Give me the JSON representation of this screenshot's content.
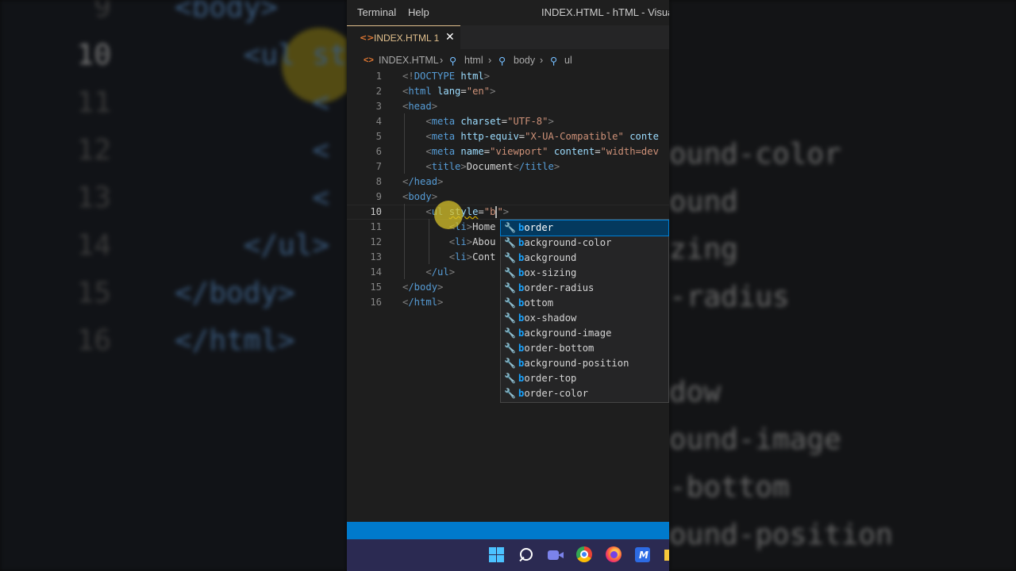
{
  "background": {
    "left_lines": [
      {
        "num": "9",
        "code": "<body>"
      },
      {
        "num": "10",
        "code": "    <ul sty"
      },
      {
        "num": "11",
        "code": "        <"
      },
      {
        "num": "12",
        "code": "        <"
      },
      {
        "num": "13",
        "code": "        <"
      },
      {
        "num": "14",
        "code": "    </ul>"
      },
      {
        "num": "15",
        "code": "</body>"
      },
      {
        "num": "16",
        "code": "</html>"
      }
    ],
    "right_lines": [
      "ound-color",
      "ound",
      "zing",
      "-radius",
      "",
      "dow",
      "ound-image",
      "-bottom",
      "ound-position"
    ]
  },
  "titlebar": {
    "menu_terminal": "Terminal",
    "menu_help": "Help",
    "window_title": "INDEX.HTML - hTML - Visual Studio Code"
  },
  "tab": {
    "icon": "<>",
    "label": "INDEX.HTML 1",
    "close": "✕"
  },
  "breadcrumb": {
    "file": "INDEX.HTML",
    "sep": "›",
    "html": "html",
    "body": "body",
    "ul": "ul"
  },
  "editor": {
    "line_numbers": [
      "1",
      "2",
      "3",
      "4",
      "5",
      "6",
      "7",
      "8",
      "9",
      "10",
      "11",
      "12",
      "13",
      "14",
      "15",
      "16"
    ],
    "active_line": "10",
    "code": {
      "l1_pre": "<!",
      "l1_tag": "DOCTYPE",
      "l1_attr": " html",
      "l1_post": ">",
      "l2_tag": "html",
      "l2_attr": "lang",
      "l2_val": "\"en\"",
      "l3_tag": "head",
      "l4_tag": "meta",
      "l4_attr": "charset",
      "l4_val": "\"UTF-8\"",
      "l5_tag": "meta",
      "l5_attr": "http-equiv",
      "l5_val": "\"X-UA-Compatible\"",
      "l5_attr2": "conte",
      "l6_tag": "meta",
      "l6_attr": "name",
      "l6_val": "\"viewport\"",
      "l6_attr2": "content",
      "l6_val2": "\"width=dev",
      "l7_tag": "title",
      "l7_text": "Document",
      "l7_tag_close": "/title",
      "l8_tag": "/head",
      "l9_tag": "body",
      "l10_tag": "ul",
      "l10_attr": "style",
      "l10_val_open": "\"",
      "l10_typed": "b",
      "l10_val_close": "\"",
      "l11_tag": "li",
      "l11_text": "Home",
      "l12_tag": "li",
      "l12_text": "Abou",
      "l13_tag": "li",
      "l13_text": "Cont",
      "l14_tag": "/ul",
      "l15_tag": "/body",
      "l16_tag": "/html"
    }
  },
  "suggestions": {
    "typed": "b",
    "items": [
      {
        "rest": "order"
      },
      {
        "rest": "ackground-color"
      },
      {
        "rest": "ackground"
      },
      {
        "rest": "ox-sizing"
      },
      {
        "rest": "order-radius"
      },
      {
        "rest": "ottom"
      },
      {
        "rest": "ox-shadow"
      },
      {
        "rest": "ackground-image"
      },
      {
        "rest": "order-bottom"
      },
      {
        "rest": "ackground-position"
      },
      {
        "rest": "order-top"
      },
      {
        "rest": "order-color"
      }
    ],
    "icon": "🔧"
  },
  "colors": {
    "status_bar": "#007acc",
    "taskbar": "#2b2a52",
    "selection": "#04395e",
    "match": "#18a3ff"
  }
}
